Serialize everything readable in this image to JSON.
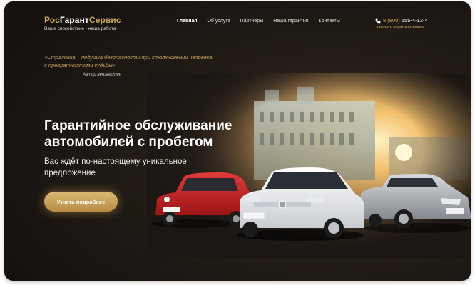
{
  "header": {
    "logo_part1": "Рос",
    "logo_part2": "Гарант",
    "logo_part3": "Сервис",
    "tagline": "Ваше спокойствие - наша работа",
    "nav": [
      {
        "label": "Главная"
      },
      {
        "label": "Об услуге"
      },
      {
        "label": "Партнеры"
      },
      {
        "label": "Наша гарантия"
      },
      {
        "label": "Контакты"
      }
    ],
    "phone_prefix": "8 (800)",
    "phone_number": " 555-4-13-4",
    "callback_label": "Заказать обратный звонок",
    "phone_icon": "phone-icon"
  },
  "quote": {
    "text": "«Страховка – подушка безопасности при столкновении человека с превратностями судьбы»",
    "author": "Автор неизвестен"
  },
  "hero": {
    "title": "Гарантийное обслуживание автомобилей с пробегом",
    "subtitle": "Вас ждёт по-настоящему уникальное предложение",
    "cta_label": "Узнать подробнее"
  },
  "colors": {
    "accent": "#c9a45c",
    "background": "#1c1713",
    "cta": "#c9a25e"
  }
}
